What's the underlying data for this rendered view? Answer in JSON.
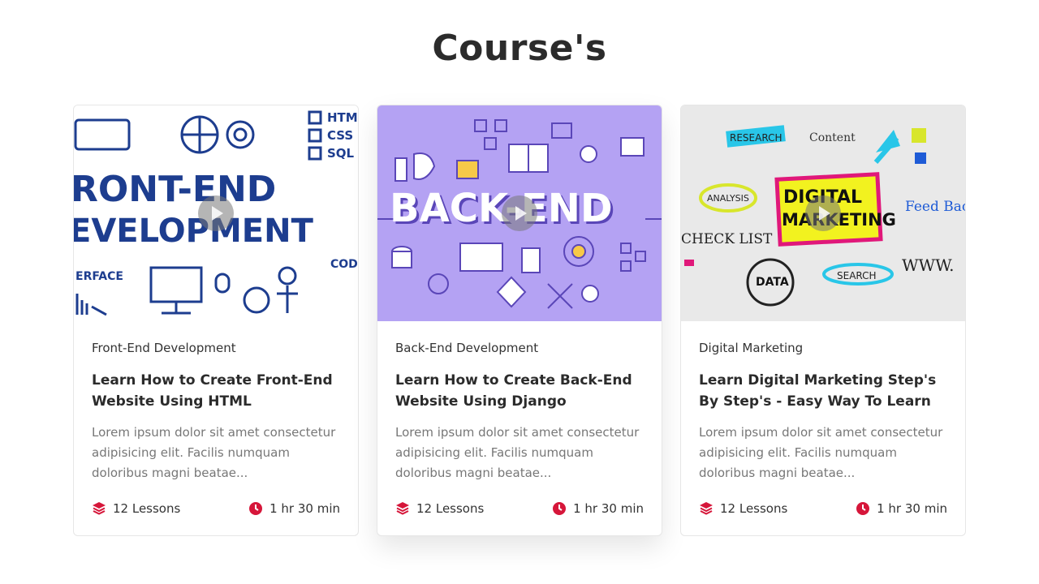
{
  "page": {
    "title": "Course's"
  },
  "colors": {
    "accent": "#d6163a",
    "backend_bg": "#b4a2f3",
    "backend_dark": "#6e5bd0",
    "frontend_ink": "#1d3d8f"
  },
  "cards": [
    {
      "image_text": [
        "RONT-END",
        "EVELOPMENT",
        "HTM",
        "CSS",
        "SQL",
        "ERFACE",
        "COD"
      ],
      "category": "Front-End Development",
      "title": "Learn How to Create Front-End Website Using HTML",
      "description": "Lorem ipsum dolor sit amet consectetur adipisicing elit. Facilis numquam doloribus magni beatae...",
      "lessons": "12 Lessons",
      "duration": "1 hr 30 min"
    },
    {
      "image_text": [
        "BACK-END"
      ],
      "category": "Back-End Development",
      "title": "Learn How to Create Back-End Website Using Django",
      "description": "Lorem ipsum dolor sit amet consectetur adipisicing elit. Facilis numquam doloribus magni beatae...",
      "lessons": "12 Lessons",
      "duration": "1 hr 30 min"
    },
    {
      "image_text": [
        "RESEARCH",
        "Content",
        "ANALYSIS",
        "DIGITAL",
        "MARKETING",
        "Feed Back",
        "CHECK LIST",
        "DATA",
        "SEARCH",
        "WWW."
      ],
      "category": "Digital Marketing",
      "title": "Learn Digital Marketing Step's By Step's - Easy Way To Learn",
      "description": "Lorem ipsum dolor sit amet consectetur adipisicing elit. Facilis numquam doloribus magni beatae...",
      "lessons": "12 Lessons",
      "duration": "1 hr 30 min"
    }
  ]
}
